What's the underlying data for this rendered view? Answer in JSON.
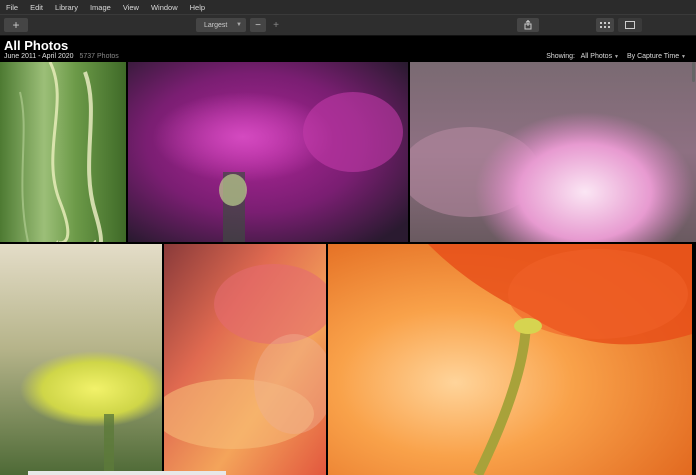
{
  "menu": {
    "items": [
      "File",
      "Edit",
      "Library",
      "Image",
      "View",
      "Window",
      "Help"
    ]
  },
  "toolbar": {
    "add_glyph": "+",
    "size_label": "Largest",
    "zoom_out_glyph": "−",
    "zoom_in_glyph": "+"
  },
  "header": {
    "title": "All Photos",
    "date_range": "June 2011 - April 2020",
    "photo_count": "5737 Photos",
    "showing_label": "Showing:",
    "showing_value": "All Photos",
    "sort_value": "By Capture Time"
  },
  "icons": {
    "add": "plus-icon",
    "share": "share-icon",
    "grid": "grid-view-icon",
    "single": "single-view-icon"
  },
  "colors": {
    "menubar": "#2b2b2b",
    "toolbar": "#2e2e2e",
    "background": "#000000"
  }
}
